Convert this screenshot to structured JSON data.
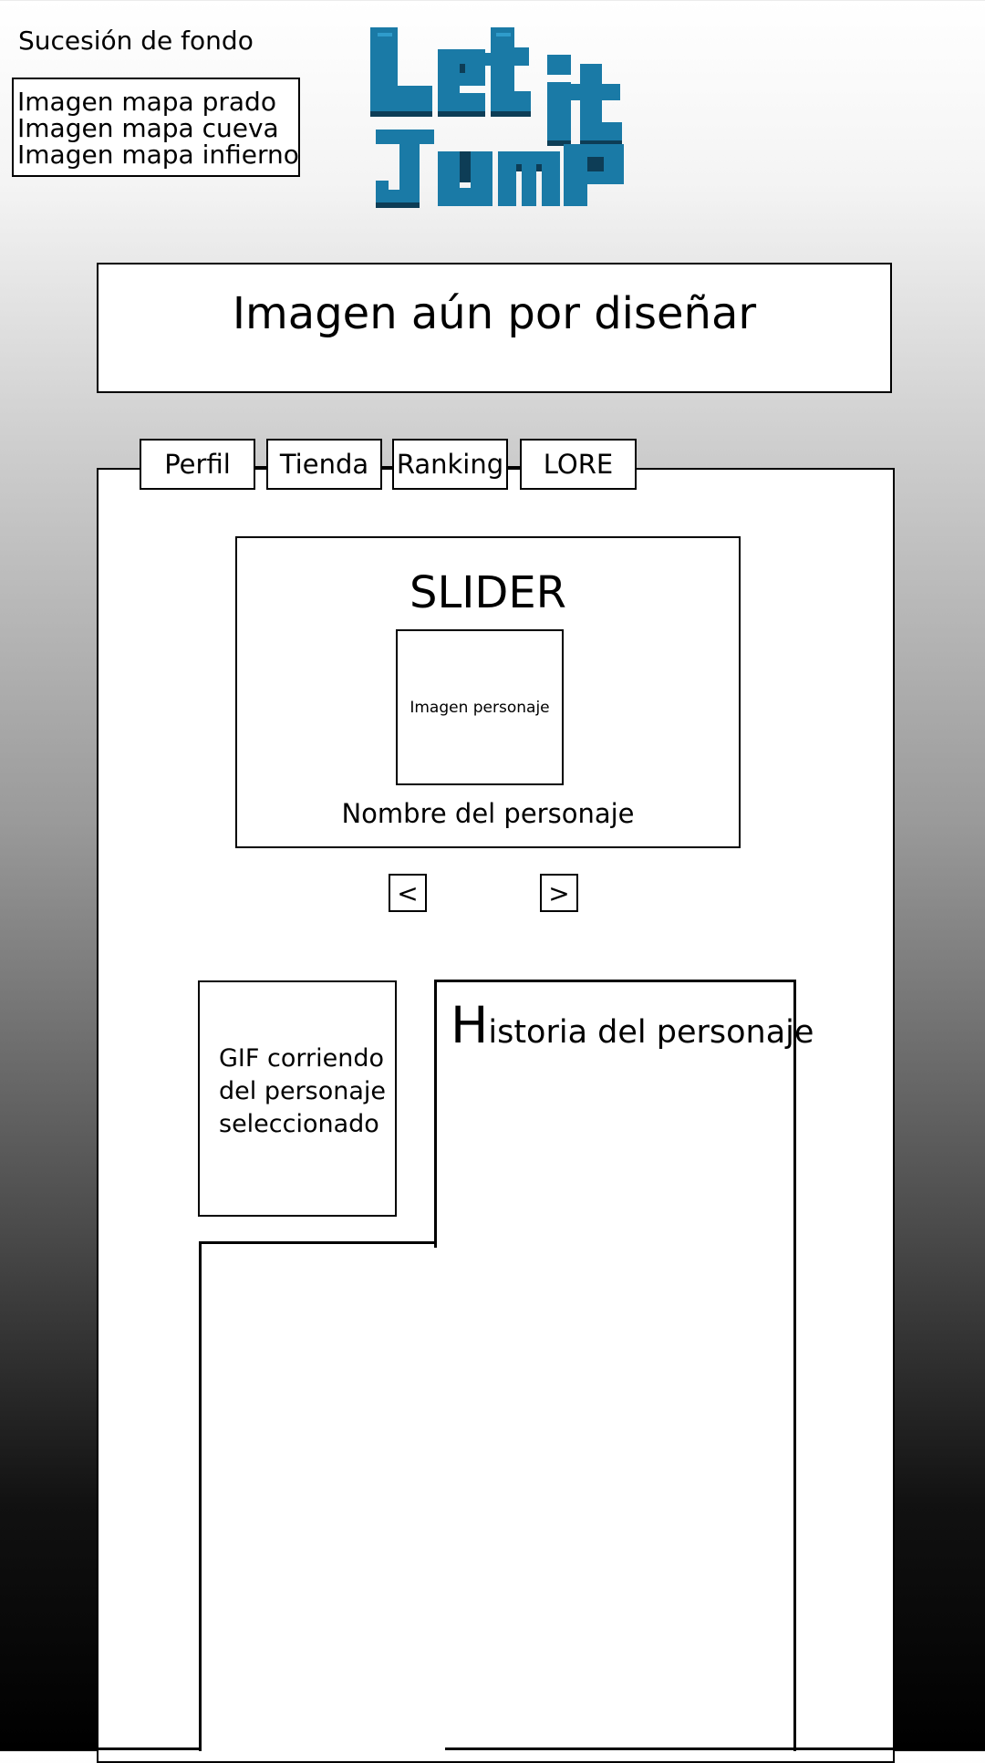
{
  "background_sequence": {
    "title": "Sucesión de fondo",
    "items": [
      "Imagen mapa prado",
      "Imagen mapa cueva",
      "Imagen mapa infierno"
    ]
  },
  "logo": {
    "alt": "Let it Jump"
  },
  "banner": {
    "text": "Imagen aún por diseñar"
  },
  "tabs": [
    {
      "label": "Perfil"
    },
    {
      "label": "Tienda"
    },
    {
      "label": "Ranking"
    },
    {
      "label": "LORE"
    }
  ],
  "slider": {
    "title": "SLIDER",
    "image_label": "Imagen personaje",
    "name_label": "Nombre del personaje",
    "prev": "<",
    "next": ">"
  },
  "gif": {
    "lines": [
      "GIF corriendo",
      "del personaje",
      "seleccionado"
    ]
  },
  "story": {
    "title_initial": "H",
    "title_rest": "istoria del personaje"
  },
  "colors": {
    "logo_blue": "#1a7aa6",
    "logo_dark": "#0d3d56"
  }
}
